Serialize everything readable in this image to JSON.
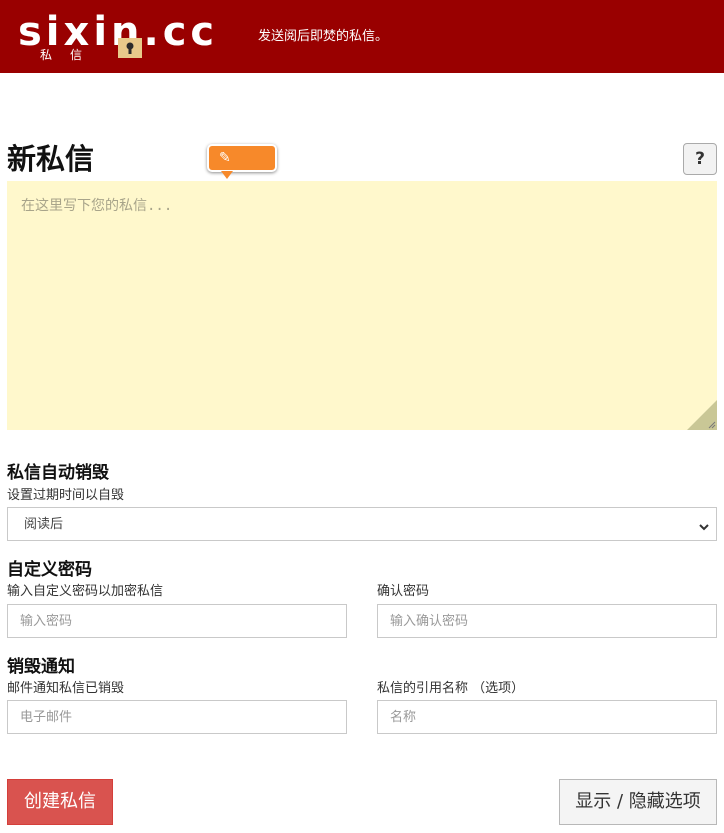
{
  "header": {
    "logo_text": "sixin.cc",
    "logo_subtitle": "私信",
    "tagline": "发送阅后即焚的私信。"
  },
  "compose": {
    "title": "新私信",
    "tip_icon": "pencil-icon",
    "help_label": "?",
    "message_placeholder": "在这里写下您的私信..."
  },
  "self_destruct": {
    "title": "私信自动销毁",
    "description": "设置过期时间以自毁",
    "selected_option": "阅读后"
  },
  "password": {
    "title": "自定义密码",
    "password_label": "输入自定义密码以加密私信",
    "password_placeholder": "输入密码",
    "confirm_label": "确认密码",
    "confirm_placeholder": "输入确认密码"
  },
  "notification": {
    "title": "销毁通知",
    "email_label": "邮件通知私信已销毁",
    "email_placeholder": "电子邮件",
    "reference_label": "私信的引用名称 （选项）",
    "reference_placeholder": "名称"
  },
  "actions": {
    "create_label": "创建私信",
    "toggle_label": "显示 / 隐藏选项"
  },
  "colors": {
    "header_bg": "#990000",
    "message_bg": "#fff8cc",
    "tip_bg": "#f7892a",
    "create_bg": "#d9534f"
  }
}
